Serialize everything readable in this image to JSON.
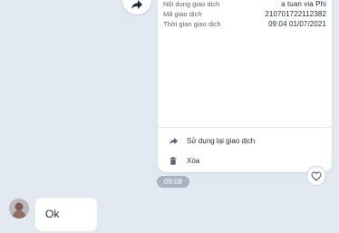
{
  "transaction": {
    "rows": [
      {
        "label": "Nội dung giao dịch",
        "value": "a tuan via Phi"
      },
      {
        "label": "Mã giao dịch",
        "value": "210701722112382"
      },
      {
        "label": "Thời gian giao dịch",
        "value": "09:04 01/07/2021"
      }
    ],
    "actions": [
      {
        "label": "Sử dụng lại giao dịch",
        "icon": "share-arrow-icon"
      },
      {
        "label": "Xóa",
        "icon": "trash-icon"
      }
    ]
  },
  "timestamp": "09:08",
  "message": {
    "text": "Ok"
  },
  "colors": {
    "background": "#e2e8ef",
    "card": "#ffffff",
    "time_pill": "#a8b3c0",
    "text": "#1f2a37"
  }
}
